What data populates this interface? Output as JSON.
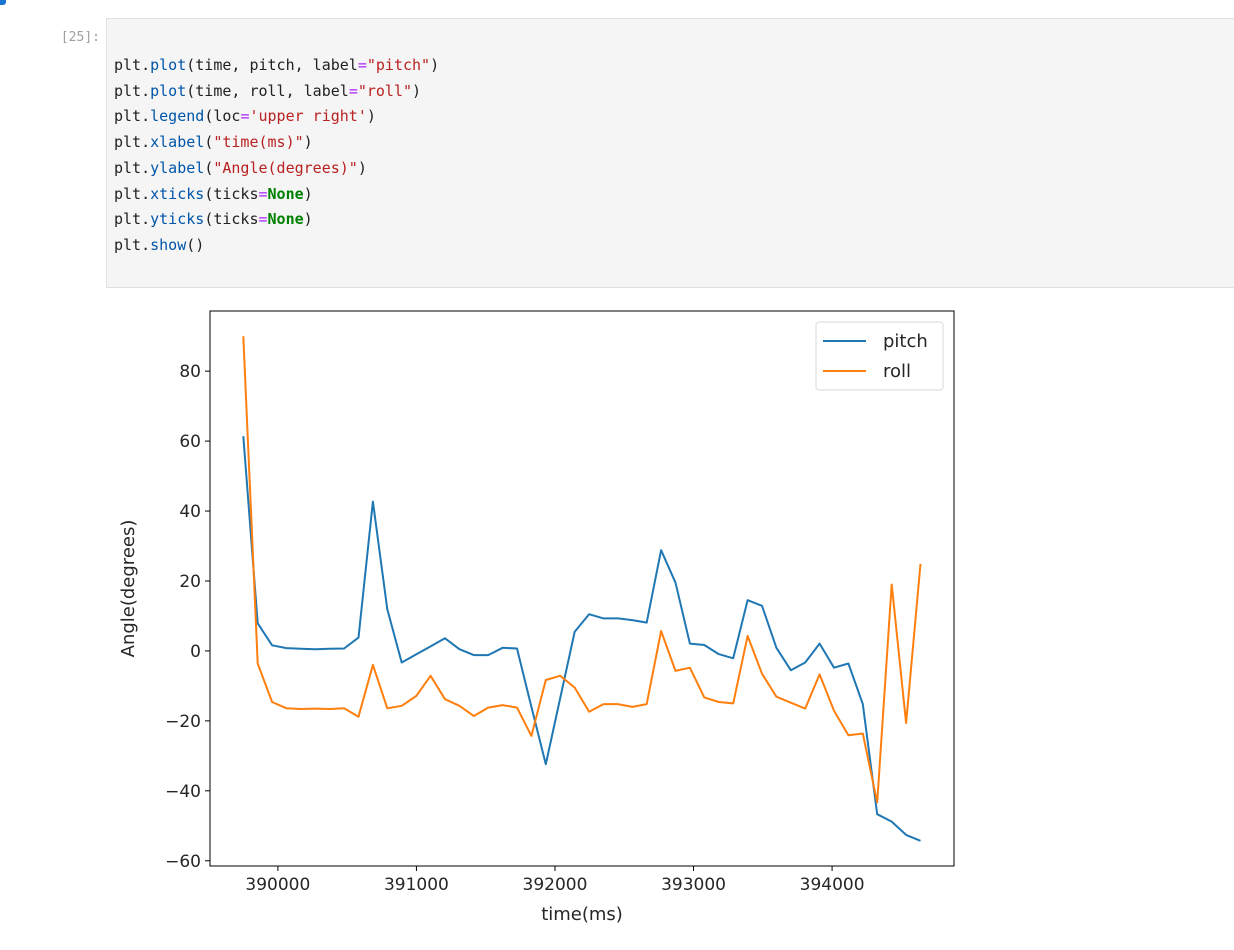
{
  "notebook": {
    "prompt": "[25]:",
    "code_lines": [
      [
        {
          "t": "plt.",
          "c": ""
        },
        {
          "t": "plot",
          "c": "fn"
        },
        {
          "t": "(time, pitch, label",
          "c": ""
        },
        {
          "t": "=",
          "c": "op"
        },
        {
          "t": "\"pitch\"",
          "c": "str"
        },
        {
          "t": ")",
          "c": ""
        }
      ],
      [
        {
          "t": "plt.",
          "c": ""
        },
        {
          "t": "plot",
          "c": "fn"
        },
        {
          "t": "(time, roll, label",
          "c": ""
        },
        {
          "t": "=",
          "c": "op"
        },
        {
          "t": "\"roll\"",
          "c": "str"
        },
        {
          "t": ")",
          "c": ""
        }
      ],
      [
        {
          "t": "plt.",
          "c": ""
        },
        {
          "t": "legend",
          "c": "fn"
        },
        {
          "t": "(loc",
          "c": ""
        },
        {
          "t": "=",
          "c": "op"
        },
        {
          "t": "'upper right'",
          "c": "str"
        },
        {
          "t": ")",
          "c": ""
        }
      ],
      [
        {
          "t": "plt.",
          "c": ""
        },
        {
          "t": "xlabel",
          "c": "fn"
        },
        {
          "t": "(",
          "c": ""
        },
        {
          "t": "\"time(ms)\"",
          "c": "str"
        },
        {
          "t": ")",
          "c": ""
        }
      ],
      [
        {
          "t": "plt.",
          "c": ""
        },
        {
          "t": "ylabel",
          "c": "fn"
        },
        {
          "t": "(",
          "c": ""
        },
        {
          "t": "\"Angle(degrees)\"",
          "c": "str"
        },
        {
          "t": ")",
          "c": ""
        }
      ],
      [
        {
          "t": "plt.",
          "c": ""
        },
        {
          "t": "xticks",
          "c": "fn"
        },
        {
          "t": "(ticks",
          "c": ""
        },
        {
          "t": "=",
          "c": "op"
        },
        {
          "t": "None",
          "c": "kw"
        },
        {
          "t": ")",
          "c": ""
        }
      ],
      [
        {
          "t": "plt.",
          "c": ""
        },
        {
          "t": "yticks",
          "c": "fn"
        },
        {
          "t": "(ticks",
          "c": ""
        },
        {
          "t": "=",
          "c": "op"
        },
        {
          "t": "None",
          "c": "kw"
        },
        {
          "t": ")",
          "c": ""
        }
      ],
      [
        {
          "t": "plt.",
          "c": ""
        },
        {
          "t": "show",
          "c": "fn"
        },
        {
          "t": "()",
          "c": ""
        }
      ]
    ]
  },
  "chart_data": {
    "type": "line",
    "title": "",
    "xlabel": "time(ms)",
    "ylabel": "Angle(degrees)",
    "xlim": [
      389510,
      394880
    ],
    "ylim": [
      -61.5,
      97.2
    ],
    "xticks": [
      390000,
      391000,
      392000,
      393000,
      394000
    ],
    "xtick_labels": [
      "390000",
      "391000",
      "392000",
      "393000",
      "394000"
    ],
    "yticks": [
      -60,
      -40,
      -20,
      0,
      20,
      40,
      60,
      80
    ],
    "ytick_labels": [
      "−60",
      "−40",
      "−20",
      "0",
      "20",
      "40",
      "60",
      "80"
    ],
    "grid": false,
    "legend": {
      "position": "upper right",
      "entries": [
        "pitch",
        "roll"
      ]
    },
    "x": [
      389750,
      389854,
      389958,
      390062,
      390166,
      390270,
      390374,
      390478,
      390582,
      390686,
      390790,
      390894,
      390998,
      391102,
      391206,
      391310,
      391414,
      391518,
      391622,
      391726,
      391830,
      391934,
      392038,
      392142,
      392246,
      392350,
      392454,
      392558,
      392662,
      392766,
      392870,
      392974,
      393078,
      393182,
      393286,
      393390,
      393494,
      393598,
      393702,
      393806,
      393910,
      394014,
      394118,
      394222,
      394326,
      394430,
      394534,
      394638
    ],
    "series": [
      {
        "name": "pitch",
        "color": "#1f77b4",
        "values": [
          61.4,
          7.9,
          1.6,
          0.8,
          0.6,
          0.5,
          0.6,
          0.7,
          3.8,
          42.7,
          11.9,
          -3.3,
          -1.0,
          1.3,
          3.6,
          0.5,
          -1.2,
          -1.2,
          0.9,
          0.7,
          -16.0,
          -32.4,
          -13.5,
          5.5,
          10.5,
          9.3,
          9.3,
          8.8,
          8.1,
          28.8,
          19.5,
          2.1,
          1.7,
          -0.9,
          -2.1,
          14.5,
          12.9,
          0.9,
          -5.5,
          -3.3,
          2.1,
          -4.8,
          -3.6,
          -15.2,
          -46.7,
          -48.8,
          -52.6,
          -54.3
        ]
      },
      {
        "name": "roll",
        "color": "#ff7f0e",
        "values": [
          90.0,
          -3.6,
          -14.6,
          -16.4,
          -16.6,
          -16.5,
          -16.6,
          -16.4,
          -18.8,
          -4.0,
          -16.4,
          -15.7,
          -12.9,
          -7.1,
          -13.8,
          -15.7,
          -18.6,
          -16.2,
          -15.5,
          -16.2,
          -24.3,
          -8.3,
          -7.1,
          -10.5,
          -17.4,
          -15.2,
          -15.2,
          -16.0,
          -15.2,
          5.7,
          -5.7,
          -4.8,
          -13.3,
          -14.6,
          -15.0,
          4.3,
          -6.5,
          -13.1,
          -14.8,
          -16.5,
          -6.7,
          -17.1,
          -24.1,
          -23.6,
          -43.3,
          19.0,
          -20.6,
          24.9
        ]
      }
    ]
  }
}
